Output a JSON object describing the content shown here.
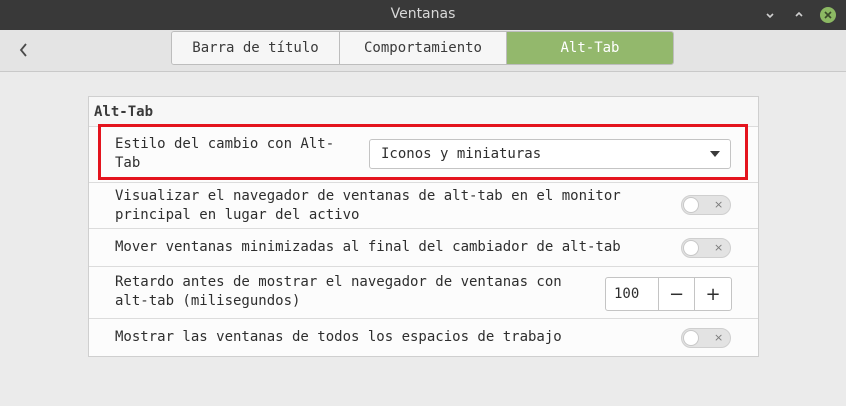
{
  "window": {
    "title": "Ventanas"
  },
  "header": {
    "tabs": [
      {
        "label": "Barra de título"
      },
      {
        "label": "Comportamiento"
      },
      {
        "label": "Alt-Tab"
      }
    ],
    "active_tab": "Alt-Tab"
  },
  "section": {
    "title": "Alt-Tab",
    "rows": [
      {
        "label": "Estilo del cambio con Alt-Tab",
        "control": "dropdown",
        "value": "Iconos y miniaturas"
      },
      {
        "label": "Visualizar el navegador de ventanas de alt-tab en el monitor principal en lugar del activo",
        "control": "switch",
        "on": false
      },
      {
        "label": "Mover ventanas minimizadas al final del cambiador de alt-tab",
        "control": "switch",
        "on": false
      },
      {
        "label": "Retardo antes de mostrar el navegador de ventanas con alt-tab (milisegundos)",
        "control": "spinbutton",
        "value": "100",
        "decrement": "−",
        "increment": "+"
      },
      {
        "label": "Mostrar las ventanas de todos los espacios de trabajo",
        "control": "switch",
        "on": false
      }
    ]
  },
  "switch_off_glyph": "×",
  "colors": {
    "accent": "#93b86c",
    "close_button": "#8cb963",
    "highlight": "#e4141e",
    "titlebar": "#393939"
  },
  "icons": [
    "minimize-icon",
    "maximize-icon",
    "close-icon",
    "back-chevron-icon",
    "dropdown-arrow-icon"
  ]
}
